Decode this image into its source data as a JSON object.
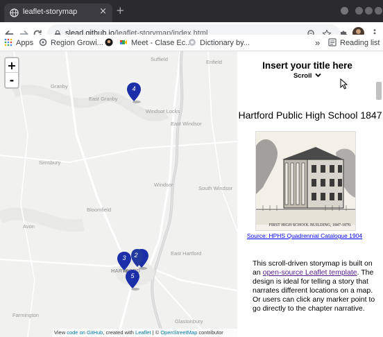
{
  "browser": {
    "tab": {
      "title": "leaflet-storymap",
      "close": "×"
    },
    "new_tab": "+",
    "url_host": "slead.github.io",
    "url_path": "/leaflet-storymap/index.html",
    "bookmarks": [
      {
        "label": "Apps",
        "color": "#4285f4"
      },
      {
        "label": "Region Growi...",
        "color": "#5f6368"
      },
      {
        "label": "",
        "color": "#1a1a1a"
      },
      {
        "label": "Meet - Clase Ec...",
        "color": "#34a853"
      },
      {
        "label": "Dictionary by...",
        "color": "#bdc1c6"
      }
    ],
    "more_bookmarks": "»",
    "reading_list": "Reading list"
  },
  "map": {
    "zoom_in": "+",
    "zoom_out": "-",
    "places": [
      {
        "name": "Suffield"
      },
      {
        "name": "Enfield"
      },
      {
        "name": "Granby"
      },
      {
        "name": "East Granby"
      },
      {
        "name": "Windsor Locks"
      },
      {
        "name": "East Windsor"
      },
      {
        "name": "Simsbury"
      },
      {
        "name": "Windsor"
      },
      {
        "name": "South Windsor"
      },
      {
        "name": "Bloomfield"
      },
      {
        "name": "Avon"
      },
      {
        "name": "East Hartford"
      },
      {
        "name": "HARTFORD"
      },
      {
        "name": "Farmington"
      },
      {
        "name": "Glastonbury"
      }
    ],
    "markers": [
      {
        "label": "4"
      },
      {
        "label": "3"
      },
      {
        "label": "2"
      },
      {
        "label": "5"
      }
    ],
    "marker_color": "#1c2fa8",
    "attribution": {
      "prefix": "View ",
      "code_link": "code on GitHub",
      "created": ", created with ",
      "leaflet_link": "Leaflet",
      "sep": " | © ",
      "osm_link": "OpenStreetMap",
      "suffix": " contributor"
    }
  },
  "narrative": {
    "title": "Insert your title here",
    "scroll_hint": "Scroll",
    "chapter_title": "Hartford Public High School 1847",
    "photo_caption": "FIRST HIGH SCHOOL BUILDING, 1847-1870.",
    "source_link": "Source: HPHS Quadrennial Catalogue 1904",
    "paragraph": {
      "before": "This scroll-driven storymap is built on an ",
      "link1": "open-source Leaflet template",
      "after": ". The design is ideal for telling a story that narrates different locations on a map. Or users can click any marker point to go directly to the chapter narrative."
    }
  }
}
